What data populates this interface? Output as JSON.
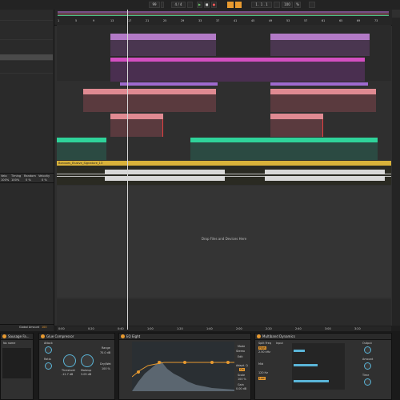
{
  "transport": {
    "tempo": "99",
    "meter": "4 / 4",
    "position": "1 . 1 . 1",
    "loop_end": "100",
    "zoom": "% "
  },
  "arrangement": {
    "ruler_ticks": [
      "1",
      "5",
      "9",
      "13",
      "17",
      "21",
      "25",
      "29",
      "33",
      "37",
      "41",
      "45",
      "49",
      "53",
      "57",
      "61",
      "65",
      "69",
      "73"
    ],
    "audio_clip_name": "Bonuses_Elusive_Signature_13",
    "drop_text": "Drop Files and Devices Here",
    "bottom_ticks": [
      "0:00",
      "0:20",
      "0:40",
      "1:00",
      "1:20",
      "1:40",
      "2:00",
      "2:20",
      "2:40",
      "3:00",
      "3:20"
    ]
  },
  "detail": {
    "labels": [
      "Velo",
      "Timing",
      "Random",
      "Velocity"
    ],
    "values": [
      "100%",
      "100%",
      "0 %",
      "0 %"
    ],
    "global_amount_label": "Global Amount",
    "global_amount_value": "100"
  },
  "devices": {
    "device1": {
      "title": "Sausage Fa...",
      "sub": "No name"
    },
    "device2": {
      "title": "Glue Compressor",
      "threshold_label": "Threshold",
      "threshold": "-12.7 dB",
      "makeup_label": "Makeup",
      "makeup": "3.09 dB",
      "attack": "Attack",
      "release": "Release",
      "ratio": "Ratio",
      "range": "Range",
      "dry_wet": "Dry/Wet",
      "range_val": "70.0 dB",
      "drywet_val": "100 %"
    },
    "device3": {
      "title": "EQ Eight",
      "mode_label": "Mode",
      "mode_val": "Stereo",
      "edit_label": "Edit",
      "adapt_label": "Adapt. Q",
      "adapt_val": "On",
      "scale_label": "Scale",
      "scale_val": "100 %",
      "gain_label": "Gain",
      "gain_val": "0.00 dB"
    },
    "device4": {
      "title": "Multiband Dynamics",
      "split_label": "Split Freq",
      "input_label": "Input",
      "hi": "High",
      "mid": "Mid",
      "low": "Low",
      "val1": "2.50 kHz",
      "val2": "120 Hz",
      "output_label": "Output",
      "amount_label": "Amount",
      "time_label": "Time"
    }
  }
}
